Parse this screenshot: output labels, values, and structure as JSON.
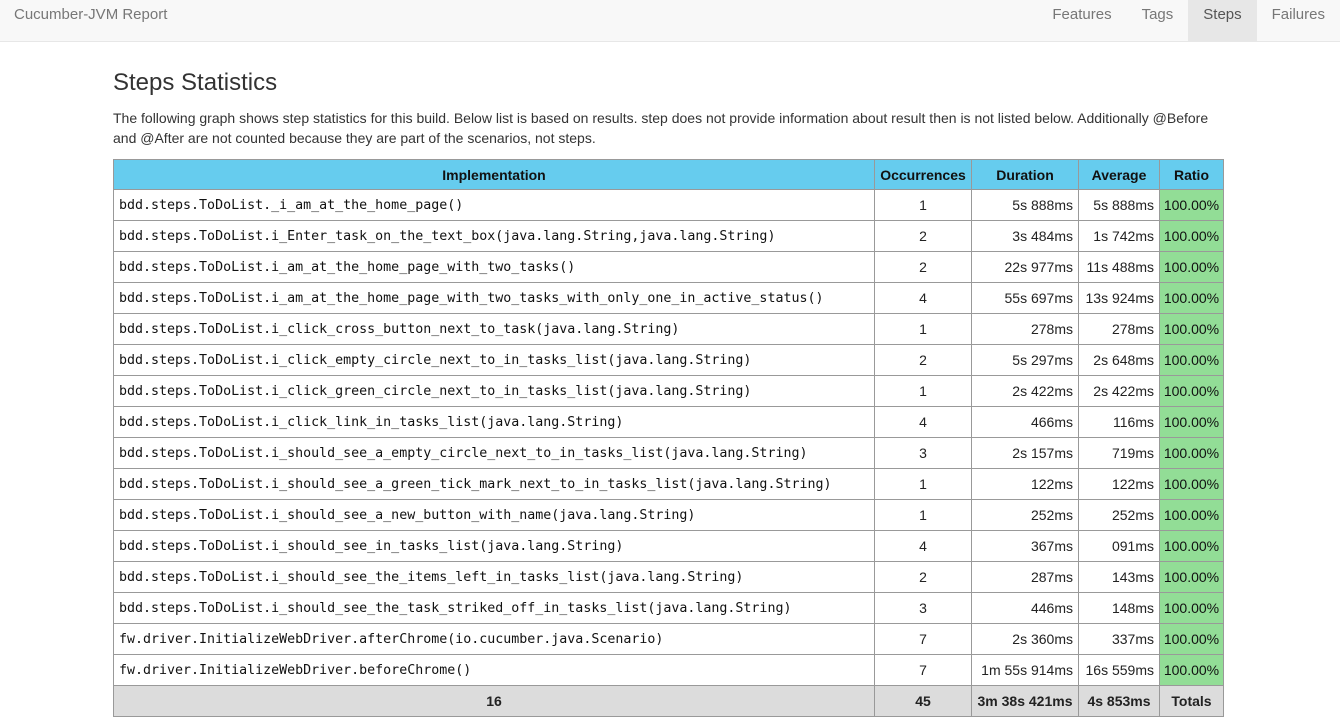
{
  "navbar": {
    "brand": "Cucumber-JVM Report",
    "items": [
      {
        "label": "Features",
        "active": false
      },
      {
        "label": "Tags",
        "active": false
      },
      {
        "label": "Steps",
        "active": true
      },
      {
        "label": "Failures",
        "active": false
      }
    ]
  },
  "page": {
    "title": "Steps Statistics",
    "description": "The following graph shows step statistics for this build. Below list is based on results. step does not provide information about result then is not listed below. Additionally @Before and @After are not counted because they are part of the scenarios, not steps."
  },
  "table": {
    "headers": {
      "implementation": "Implementation",
      "occurrences": "Occurrences",
      "duration": "Duration",
      "average": "Average",
      "ratio": "Ratio"
    },
    "rows": [
      {
        "implementation": "bdd.steps.ToDoList._i_am_at_the_home_page()",
        "occurrences": "1",
        "duration": "5s 888ms",
        "average": "5s 888ms",
        "ratio": "100.00%"
      },
      {
        "implementation": "bdd.steps.ToDoList.i_Enter_task_on_the_text_box(java.lang.String,java.lang.String)",
        "occurrences": "2",
        "duration": "3s 484ms",
        "average": "1s 742ms",
        "ratio": "100.00%"
      },
      {
        "implementation": "bdd.steps.ToDoList.i_am_at_the_home_page_with_two_tasks()",
        "occurrences": "2",
        "duration": "22s 977ms",
        "average": "11s 488ms",
        "ratio": "100.00%"
      },
      {
        "implementation": "bdd.steps.ToDoList.i_am_at_the_home_page_with_two_tasks_with_only_one_in_active_status()",
        "occurrences": "4",
        "duration": "55s 697ms",
        "average": "13s 924ms",
        "ratio": "100.00%"
      },
      {
        "implementation": "bdd.steps.ToDoList.i_click_cross_button_next_to_task(java.lang.String)",
        "occurrences": "1",
        "duration": "278ms",
        "average": "278ms",
        "ratio": "100.00%"
      },
      {
        "implementation": "bdd.steps.ToDoList.i_click_empty_circle_next_to_in_tasks_list(java.lang.String)",
        "occurrences": "2",
        "duration": "5s 297ms",
        "average": "2s 648ms",
        "ratio": "100.00%"
      },
      {
        "implementation": "bdd.steps.ToDoList.i_click_green_circle_next_to_in_tasks_list(java.lang.String)",
        "occurrences": "1",
        "duration": "2s 422ms",
        "average": "2s 422ms",
        "ratio": "100.00%"
      },
      {
        "implementation": "bdd.steps.ToDoList.i_click_link_in_tasks_list(java.lang.String)",
        "occurrences": "4",
        "duration": "466ms",
        "average": "116ms",
        "ratio": "100.00%"
      },
      {
        "implementation": "bdd.steps.ToDoList.i_should_see_a_empty_circle_next_to_in_tasks_list(java.lang.String)",
        "occurrences": "3",
        "duration": "2s 157ms",
        "average": "719ms",
        "ratio": "100.00%"
      },
      {
        "implementation": "bdd.steps.ToDoList.i_should_see_a_green_tick_mark_next_to_in_tasks_list(java.lang.String)",
        "occurrences": "1",
        "duration": "122ms",
        "average": "122ms",
        "ratio": "100.00%"
      },
      {
        "implementation": "bdd.steps.ToDoList.i_should_see_a_new_button_with_name(java.lang.String)",
        "occurrences": "1",
        "duration": "252ms",
        "average": "252ms",
        "ratio": "100.00%"
      },
      {
        "implementation": "bdd.steps.ToDoList.i_should_see_in_tasks_list(java.lang.String)",
        "occurrences": "4",
        "duration": "367ms",
        "average": "091ms",
        "ratio": "100.00%"
      },
      {
        "implementation": "bdd.steps.ToDoList.i_should_see_the_items_left_in_tasks_list(java.lang.String)",
        "occurrences": "2",
        "duration": "287ms",
        "average": "143ms",
        "ratio": "100.00%"
      },
      {
        "implementation": "bdd.steps.ToDoList.i_should_see_the_task_striked_off_in_tasks_list(java.lang.String)",
        "occurrences": "3",
        "duration": "446ms",
        "average": "148ms",
        "ratio": "100.00%"
      },
      {
        "implementation": "fw.driver.InitializeWebDriver.afterChrome(io.cucumber.java.Scenario)",
        "occurrences": "7",
        "duration": "2s 360ms",
        "average": "337ms",
        "ratio": "100.00%"
      },
      {
        "implementation": "fw.driver.InitializeWebDriver.beforeChrome()",
        "occurrences": "7",
        "duration": "1m 55s 914ms",
        "average": "16s 559ms",
        "ratio": "100.00%"
      }
    ],
    "totals": {
      "implementation": "16",
      "occurrences": "45",
      "duration": "3m 38s 421ms",
      "average": "4s 853ms",
      "ratio": "Totals"
    }
  },
  "colors": {
    "header_bg": "#66ccee",
    "ratio_passed_bg": "#92dd96",
    "totals_bg": "#dcdcdc"
  }
}
